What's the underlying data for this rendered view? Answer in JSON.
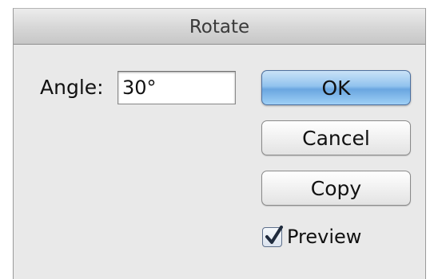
{
  "dialog": {
    "title": "Rotate",
    "angle": {
      "label": "Angle:",
      "value": "30°"
    },
    "buttons": {
      "ok": "OK",
      "cancel": "Cancel",
      "copy": "Copy"
    },
    "preview": {
      "label": "Preview",
      "checked": true,
      "icon": "checkmark-icon"
    },
    "colors": {
      "primary_button": "#6aa6e0",
      "dialog_background": "#e9e9e9"
    }
  }
}
